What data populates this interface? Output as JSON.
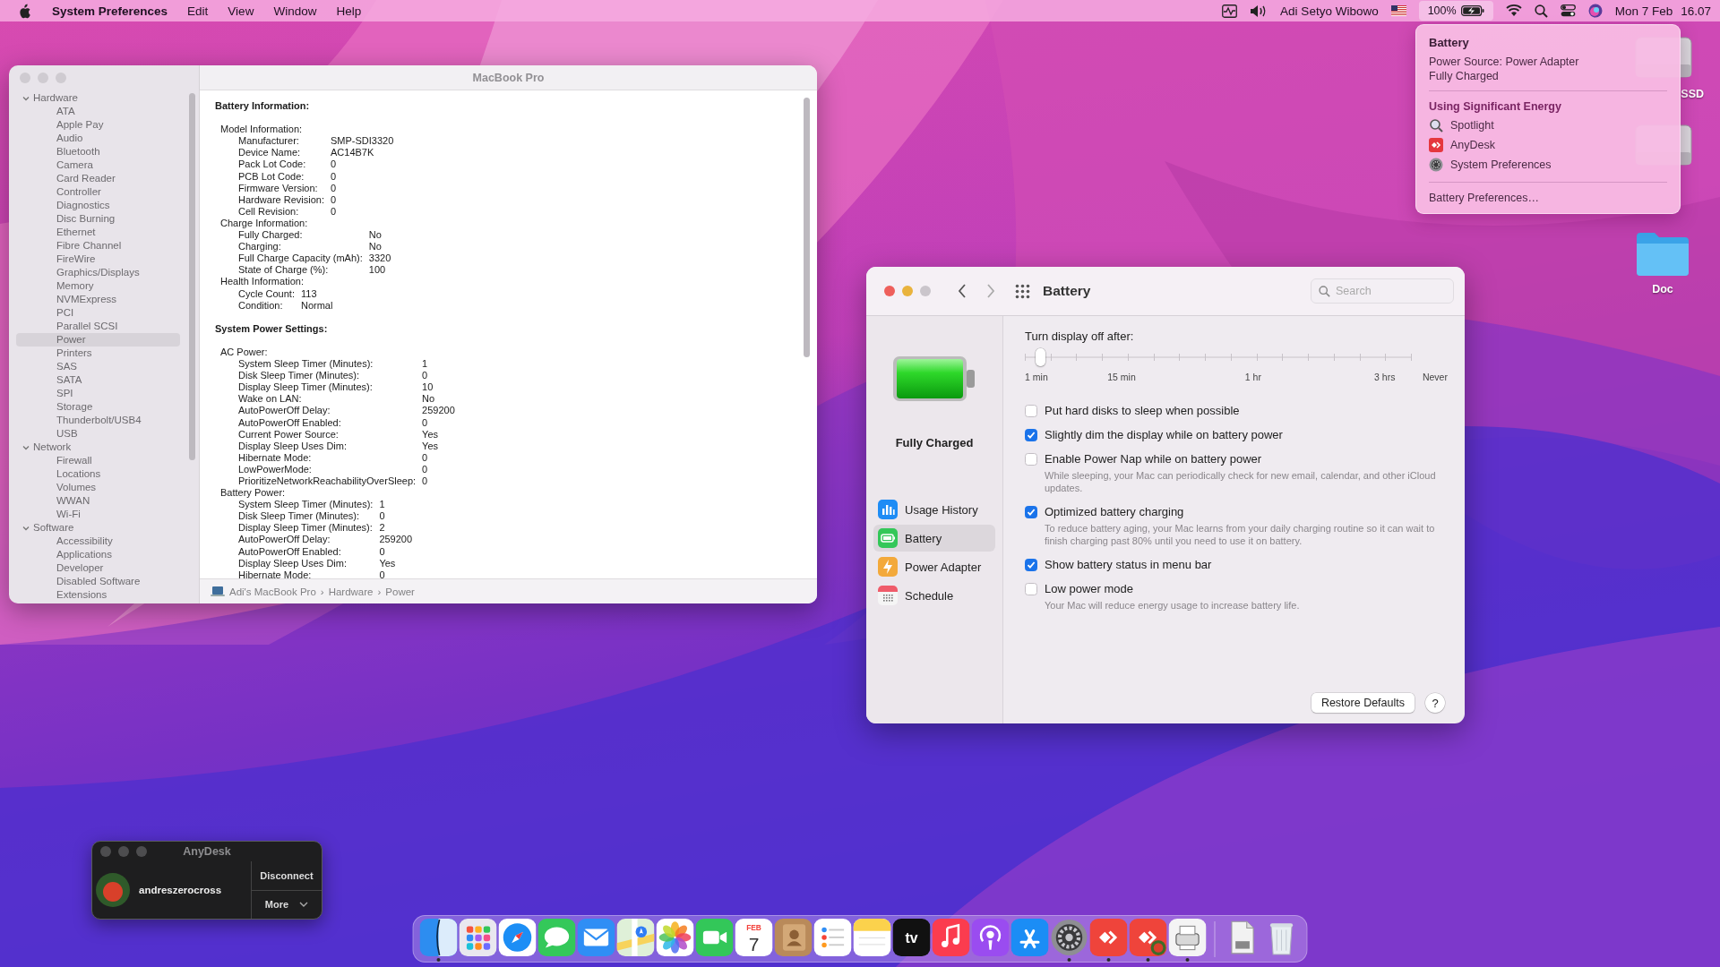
{
  "menu_bar": {
    "app_name": "System Preferences",
    "menus": [
      "Edit",
      "View",
      "Window",
      "Help"
    ],
    "user_name": "Adi Setyo Wibowo",
    "battery": {
      "percent": "100%",
      "selected": true
    },
    "date": "Mon 7 Feb",
    "time": "16.07"
  },
  "desktop_icons": [
    {
      "kind": "drive",
      "label": "SSD"
    },
    {
      "kind": "drive"
    },
    {
      "kind": "folder",
      "label": "Doc"
    }
  ],
  "system_info": {
    "title": "MacBook Pro",
    "sidebar": [
      {
        "label": "Hardware",
        "expanded": true,
        "selected": false,
        "children": [
          {
            "label": "ATA",
            "selected": false
          },
          {
            "label": "Apple Pay",
            "selected": false
          },
          {
            "label": "Audio",
            "selected": false
          },
          {
            "label": "Bluetooth",
            "selected": false
          },
          {
            "label": "Camera",
            "selected": false
          },
          {
            "label": "Card Reader",
            "selected": false
          },
          {
            "label": "Controller",
            "selected": false
          },
          {
            "label": "Diagnostics",
            "selected": false
          },
          {
            "label": "Disc Burning",
            "selected": false
          },
          {
            "label": "Ethernet",
            "selected": false
          },
          {
            "label": "Fibre Channel",
            "selected": false
          },
          {
            "label": "FireWire",
            "selected": false
          },
          {
            "label": "Graphics/Displays",
            "selected": false
          },
          {
            "label": "Memory",
            "selected": false
          },
          {
            "label": "NVMExpress",
            "selected": false
          },
          {
            "label": "PCI",
            "selected": false
          },
          {
            "label": "Parallel SCSI",
            "selected": false
          },
          {
            "label": "Power",
            "selected": true
          },
          {
            "label": "Printers",
            "selected": false
          },
          {
            "label": "SAS",
            "selected": false
          },
          {
            "label": "SATA",
            "selected": false
          },
          {
            "label": "SPI",
            "selected": false
          },
          {
            "label": "Storage",
            "selected": false
          },
          {
            "label": "Thunderbolt/USB4",
            "selected": false
          },
          {
            "label": "USB",
            "selected": false
          }
        ]
      },
      {
        "label": "Network",
        "expanded": true,
        "selected": false,
        "children": [
          {
            "label": "Firewall",
            "selected": false
          },
          {
            "label": "Locations",
            "selected": false
          },
          {
            "label": "Volumes",
            "selected": false
          },
          {
            "label": "WWAN",
            "selected": false
          },
          {
            "label": "Wi-Fi",
            "selected": false
          }
        ]
      },
      {
        "label": "Software",
        "expanded": true,
        "selected": false,
        "children": [
          {
            "label": "Accessibility",
            "selected": false
          },
          {
            "label": "Applications",
            "selected": false
          },
          {
            "label": "Developer",
            "selected": false
          },
          {
            "label": "Disabled Software",
            "selected": false
          },
          {
            "label": "Extensions",
            "selected": false
          }
        ]
      }
    ],
    "sections": [
      {
        "title": "Battery Information:",
        "groups": [
          {
            "title": "Model Information:",
            "rows": [
              {
                "label": "Manufacturer:",
                "value": "SMP-SDI3320"
              },
              {
                "label": "Device Name:",
                "value": "AC14B7K"
              },
              {
                "label": "Pack Lot Code:",
                "value": "0"
              },
              {
                "label": "PCB Lot Code:",
                "value": "0"
              },
              {
                "label": "Firmware Version:",
                "value": "0"
              },
              {
                "label": "Hardware Revision:",
                "value": "0"
              },
              {
                "label": "Cell Revision:",
                "value": "0"
              }
            ]
          },
          {
            "title": "Charge Information:",
            "rows": [
              {
                "label": "Fully Charged:",
                "value": "No"
              },
              {
                "label": "Charging:",
                "value": "No"
              },
              {
                "label": "Full Charge Capacity (mAh):",
                "value": "3320"
              },
              {
                "label": "State of Charge (%):",
                "value": "100"
              }
            ]
          },
          {
            "title": "Health Information:",
            "rows": [
              {
                "label": "Cycle Count:",
                "value": "113"
              },
              {
                "label": "Condition:",
                "value": "Normal"
              }
            ]
          }
        ]
      },
      {
        "title": "System Power Settings:",
        "groups": [
          {
            "title": "AC Power:",
            "rows": [
              {
                "label": "System Sleep Timer (Minutes):",
                "value": "1"
              },
              {
                "label": "Disk Sleep Timer (Minutes):",
                "value": "0"
              },
              {
                "label": "Display Sleep Timer (Minutes):",
                "value": "10"
              },
              {
                "label": "Wake on LAN:",
                "value": "No"
              },
              {
                "label": "AutoPowerOff Delay:",
                "value": "259200"
              },
              {
                "label": "AutoPowerOff Enabled:",
                "value": "0"
              },
              {
                "label": "Current Power Source:",
                "value": "Yes"
              },
              {
                "label": "Display Sleep Uses Dim:",
                "value": "Yes"
              },
              {
                "label": "Hibernate Mode:",
                "value": "0"
              },
              {
                "label": "LowPowerMode:",
                "value": "0"
              },
              {
                "label": "PrioritizeNetworkReachabilityOverSleep:",
                "value": "0"
              }
            ]
          },
          {
            "title": "Battery Power:",
            "rows": [
              {
                "label": "System Sleep Timer (Minutes):",
                "value": "1"
              },
              {
                "label": "Disk Sleep Timer (Minutes):",
                "value": "0"
              },
              {
                "label": "Display Sleep Timer (Minutes):",
                "value": "2"
              },
              {
                "label": "AutoPowerOff Delay:",
                "value": "259200"
              },
              {
                "label": "AutoPowerOff Enabled:",
                "value": "0"
              },
              {
                "label": "Display Sleep Uses Dim:",
                "value": "Yes"
              },
              {
                "label": "Hibernate Mode:",
                "value": "0"
              }
            ]
          }
        ]
      }
    ],
    "path": [
      "Adi's MacBook Pro",
      "Hardware",
      "Power"
    ],
    "path_separator": "›"
  },
  "battery_prefs": {
    "title": "Battery",
    "search_placeholder": "Search",
    "status": "Fully Charged",
    "nav": [
      {
        "kind": "usage_history",
        "label": "Usage History",
        "selected": false
      },
      {
        "kind": "battery",
        "label": "Battery",
        "selected": true
      },
      {
        "kind": "power_adapter",
        "label": "Power Adapter",
        "selected": false
      },
      {
        "kind": "schedule",
        "label": "Schedule",
        "selected": false
      }
    ],
    "slider": {
      "label": "Turn display off after:",
      "level": 0.04,
      "ticks": [
        "1 min",
        "15 min",
        "1 hr",
        "3 hrs",
        "Never"
      ]
    },
    "options": [
      {
        "label": "Put hard disks to sleep when possible",
        "checked": false
      },
      {
        "label": "Slightly dim the display while on battery power",
        "checked": true
      },
      {
        "label": "Enable Power Nap while on battery power",
        "checked": false,
        "description": "While sleeping, your Mac can periodically check for new email, calendar, and other iCloud updates."
      },
      {
        "label": "Optimized battery charging",
        "checked": true,
        "description": "To reduce battery aging, your Mac learns from your daily charging routine so it can wait to finish charging past 80% until you need to use it on battery."
      },
      {
        "label": "Show battery status in menu bar",
        "checked": true
      },
      {
        "label": "Low power mode",
        "checked": false,
        "description": "Your Mac will reduce energy usage to increase battery life."
      }
    ],
    "restore_button": "Restore Defaults",
    "help_button": "?"
  },
  "battery_menu": {
    "title": "Battery",
    "power_source": "Power Source: Power Adapter",
    "status": "Fully Charged",
    "section_title": "Using Significant Energy",
    "apps": [
      {
        "kind": "spotlight",
        "name": "Spotlight"
      },
      {
        "kind": "anydesk",
        "name": "AnyDesk"
      },
      {
        "kind": "system_preferences",
        "name": "System Preferences"
      }
    ],
    "footer": "Battery Preferences…"
  },
  "anydesk": {
    "title": "AnyDesk",
    "user": "andreszerocross",
    "disconnect_button": "Disconnect",
    "more_button": "More"
  },
  "dock": {
    "apps": [
      {
        "kind": "finder",
        "running": true
      },
      {
        "kind": "launchpad",
        "running": false
      },
      {
        "kind": "safari",
        "running": false
      },
      {
        "kind": "messages",
        "running": false
      },
      {
        "kind": "mail",
        "running": false
      },
      {
        "kind": "maps",
        "running": false
      },
      {
        "kind": "photos",
        "running": false
      },
      {
        "kind": "facetime",
        "running": false
      },
      {
        "kind": "calendar",
        "month": "FEB",
        "day": "7",
        "running": false
      },
      {
        "kind": "contacts",
        "running": false
      },
      {
        "kind": "reminders",
        "running": false
      },
      {
        "kind": "notes",
        "running": false
      },
      {
        "kind": "tv",
        "label": "tv",
        "running": false
      },
      {
        "kind": "music",
        "running": false
      },
      {
        "kind": "podcasts",
        "running": false
      },
      {
        "kind": "app_store",
        "running": false
      },
      {
        "kind": "system_preferences",
        "running": true
      },
      {
        "kind": "anydesk",
        "running": true
      },
      {
        "kind": "anydesk_session",
        "running": true
      },
      {
        "kind": "scanner",
        "running": true
      }
    ],
    "stacks": [
      {
        "kind": "document"
      },
      {
        "kind": "trash"
      }
    ]
  }
}
